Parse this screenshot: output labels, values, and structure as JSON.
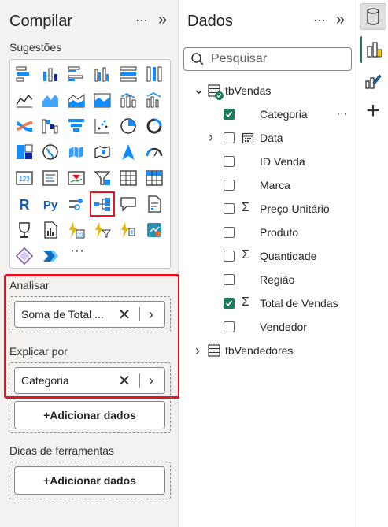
{
  "build_pane": {
    "title": "Compilar",
    "more": "⋯",
    "collapse": "»",
    "suggestions_label": "Sugestões",
    "more_visuals": "⋯",
    "analyze_label": "Analisar",
    "analyze_field": "Soma de Total ...",
    "explain_by_label": "Explicar por",
    "explain_by_field": "Categoria",
    "add_data_label": "+Adicionar dados",
    "tooltips_label": "Dicas de ferramentas",
    "tooltips_add_label": "+Adicionar dados",
    "visual_icons": [
      "stacked-bar-icon",
      "stacked-column-icon",
      "clustered-bar-icon",
      "clustered-column-icon",
      "100-stacked-bar-icon",
      "100-stacked-column-icon",
      "line-chart-icon",
      "area-chart-icon",
      "stacked-area-icon",
      "100-stacked-area-icon",
      "line-stacked-column-icon",
      "line-clustered-column-icon",
      "ribbon-chart-icon",
      "waterfall-chart-icon",
      "funnel-chart-icon",
      "scatter-chart-icon",
      "pie-chart-icon",
      "donut-chart-icon",
      "treemap-icon",
      "map-icon",
      "filled-map-icon",
      "shape-map-icon",
      "azure-map-icon",
      "gauge-icon",
      "card-icon",
      "multi-row-card-icon",
      "kpi-icon",
      "slicer-icon",
      "table-icon",
      "matrix-icon",
      "r-visual-icon",
      "python-visual-icon",
      "key-influencers-icon",
      "decomposition-tree-icon",
      "qa-icon",
      "smart-narrative-icon",
      "goals-icon",
      "paginated-report-icon",
      "power-apps-icon",
      "power-automate-icon",
      "flow-filter-icon",
      "data-map-icon",
      "diamond-visual-icon",
      "chevron-visual-icon"
    ]
  },
  "data_pane": {
    "title": "Dados",
    "more": "⋯",
    "collapse": "»",
    "search_placeholder": "Pesquisar",
    "tables": [
      {
        "name": "tbVendas",
        "expanded": true,
        "fields": [
          {
            "name": "Categoria",
            "checked": true,
            "sigma": false,
            "has_more": true,
            "more": "⋯"
          },
          {
            "name": "Data",
            "checked": false,
            "sigma": false,
            "calendar": true,
            "expandable": true
          },
          {
            "name": "ID Venda",
            "checked": false,
            "sigma": false
          },
          {
            "name": "Marca",
            "checked": false,
            "sigma": false
          },
          {
            "name": "Preço Unitário",
            "checked": false,
            "sigma": true
          },
          {
            "name": "Produto",
            "checked": false,
            "sigma": false
          },
          {
            "name": "Quantidade",
            "checked": false,
            "sigma": true
          },
          {
            "name": "Região",
            "checked": false,
            "sigma": false
          },
          {
            "name": "Total de Vendas",
            "checked": true,
            "sigma": true
          },
          {
            "name": "Vendedor",
            "checked": false,
            "sigma": false
          }
        ]
      },
      {
        "name": "tbVendedores",
        "expanded": false
      }
    ]
  },
  "rail": {
    "icons": [
      "data-cylinder-icon",
      "build-visual-icon",
      "format-brush-icon",
      "plus-icon"
    ],
    "plus": "+"
  },
  "colors": {
    "accent_green": "#1f7a57",
    "highlight_red": "#e81123",
    "pane_gray": "#f3f2f1"
  }
}
